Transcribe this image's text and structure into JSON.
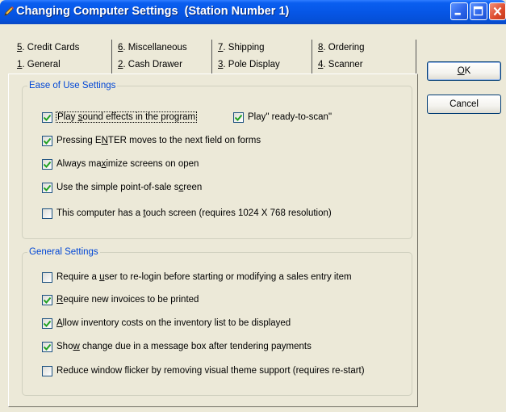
{
  "window": {
    "title": "Changing Computer Settings  (Station Number 1)"
  },
  "tabs": {
    "row1": [
      {
        "mnemonic": "5",
        "label": ". Credit Cards"
      },
      {
        "mnemonic": "6",
        "label": ". Miscellaneous"
      },
      {
        "mnemonic": "7",
        "label": ". Shipping"
      },
      {
        "mnemonic": "8",
        "label": ". Ordering"
      }
    ],
    "row2": [
      {
        "mnemonic": "1",
        "label": ". General",
        "active": true
      },
      {
        "mnemonic": "2",
        "label": ". Cash Drawer"
      },
      {
        "mnemonic": "3",
        "label": ".  Pole Display"
      },
      {
        "mnemonic": "4",
        "label": ". Scanner"
      }
    ]
  },
  "ease_of_use": {
    "legend": "Ease of Use Settings",
    "items": [
      {
        "pre": "Play ",
        "mn": "s",
        "post": "ound effects in the program",
        "checked": true
      },
      {
        "pre": "Play\" ready-to-scan\"",
        "mn": "",
        "post": "",
        "checked": true
      },
      {
        "pre": "Pressing E",
        "mn": "N",
        "post": "TER moves to the next field on forms",
        "checked": true
      },
      {
        "pre": "Always ma",
        "mn": "x",
        "post": "imize screens on open",
        "checked": true
      },
      {
        "pre": "Use the simple point-of-sale s",
        "mn": "c",
        "post": "reen",
        "checked": true
      },
      {
        "pre": "This computer has a ",
        "mn": "t",
        "post": "ouch screen (requires 1024 X 768 resolution)",
        "checked": false
      }
    ]
  },
  "general": {
    "legend": "General Settings",
    "items": [
      {
        "pre": "Require a ",
        "mn": "u",
        "post": "ser to re-login before starting or modifying a sales entry item",
        "checked": false
      },
      {
        "pre": "",
        "mn": "R",
        "post": "equire new invoices to be printed",
        "checked": true
      },
      {
        "pre": "",
        "mn": "A",
        "post": "llow inventory costs on the inventory list to be displayed",
        "checked": true
      },
      {
        "pre": "Sho",
        "mn": "w",
        "post": " change due in a message box after tendering payments",
        "checked": true
      },
      {
        "pre": "Reduce window flicker by removing visual theme support (requires re-start)",
        "mn": "",
        "post": "",
        "checked": false
      }
    ]
  },
  "buttons": {
    "ok_mn": "O",
    "ok_rest": "K",
    "cancel": "Cancel"
  },
  "icons": {
    "title": "pencil-icon",
    "checkmark": "check-icon"
  }
}
